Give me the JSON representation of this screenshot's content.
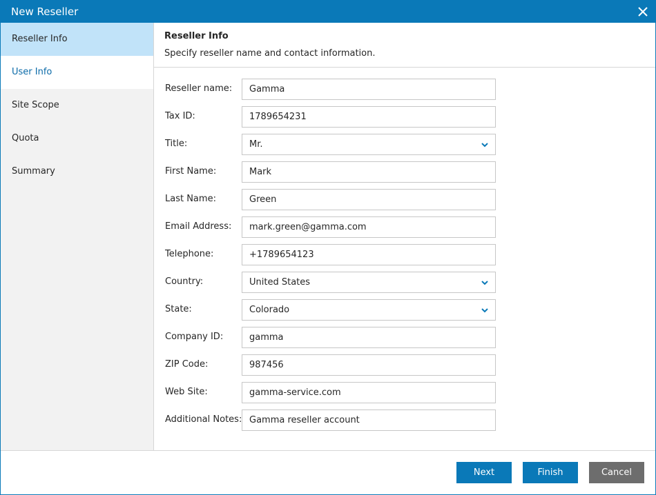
{
  "window": {
    "title": "New Reseller",
    "close_icon": "close-icon"
  },
  "colors": {
    "accent": "#0a79b8",
    "sidebar_bg": "#f2f2f2",
    "sidebar_active": "#c1e3f9",
    "cancel_button": "#6d6d6d"
  },
  "sidebar": {
    "items": [
      {
        "label": "Reseller Info",
        "state": "active"
      },
      {
        "label": "User Info",
        "state": "highlighted"
      },
      {
        "label": "Site Scope",
        "state": "normal"
      },
      {
        "label": "Quota",
        "state": "normal"
      },
      {
        "label": "Summary",
        "state": "normal"
      }
    ]
  },
  "header": {
    "title": "Reseller Info",
    "subtitle": "Specify reseller name and contact information."
  },
  "form": {
    "reseller_name": {
      "label": "Reseller name:",
      "value": "Gamma"
    },
    "tax_id": {
      "label": "Tax ID:",
      "value": "1789654231"
    },
    "title": {
      "label": "Title:",
      "value": "Mr."
    },
    "first_name": {
      "label": "First Name:",
      "value": "Mark"
    },
    "last_name": {
      "label": "Last Name:",
      "value": "Green"
    },
    "email": {
      "label": "Email Address:",
      "value": "mark.green@gamma.com"
    },
    "telephone": {
      "label": "Telephone:",
      "value": "+1789654123"
    },
    "country": {
      "label": "Country:",
      "value": "United States"
    },
    "state": {
      "label": "State:",
      "value": "Colorado"
    },
    "company_id": {
      "label": "Company ID:",
      "value": "gamma"
    },
    "zip": {
      "label": "ZIP Code:",
      "value": "987456"
    },
    "website": {
      "label": "Web Site:",
      "value": "gamma-service.com"
    },
    "notes": {
      "label": "Additional Notes:",
      "value": "Gamma reseller account"
    }
  },
  "footer": {
    "next_label": "Next",
    "finish_label": "Finish",
    "cancel_label": "Cancel"
  }
}
